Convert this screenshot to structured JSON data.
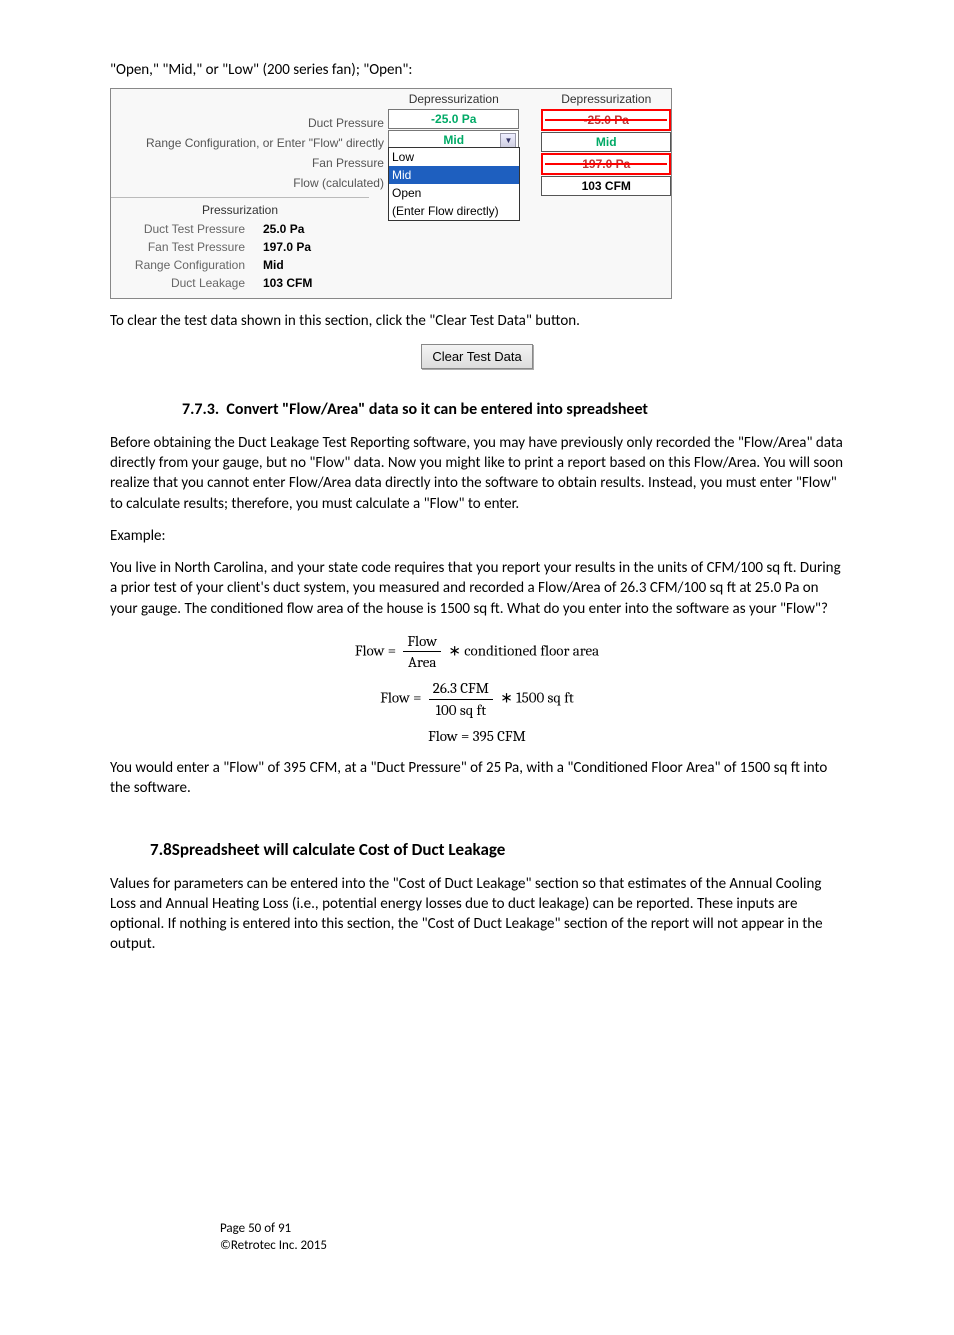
{
  "intro": "\"Open,\" \"Mid,\" or \"Low\" (200 series fan); \"Open\":",
  "ss": {
    "labels": {
      "header": "Depressurization",
      "duct_pressure": "Duct Pressure",
      "range": "Range Configuration, or Enter \"Flow\" directly",
      "fan_pressure": "Fan Pressure",
      "flow": "Flow (calculated)"
    },
    "mid": {
      "duct_val": "-25.0 Pa",
      "range_val": "Mid",
      "dd": {
        "low": "Low",
        "mid": "Mid",
        "open": "Open",
        "enter": "(Enter Flow directly)"
      }
    },
    "right": {
      "header": "Depressurization",
      "v1": "-25.0 Pa",
      "v2": "Mid",
      "v3": "197.0 Pa",
      "v4": "103 CFM"
    },
    "bottom": {
      "header": "Pressurization",
      "rows": [
        {
          "label": "Duct Test Pressure",
          "val": "25.0 Pa"
        },
        {
          "label": "Fan Test Pressure",
          "val": "197.0 Pa"
        },
        {
          "label": "Range Configuration",
          "val": "Mid"
        },
        {
          "label": "Duct Leakage",
          "val": "103 CFM"
        }
      ]
    }
  },
  "clear_text": "To clear the test data shown in this section, click the \"Clear Test Data\" button.",
  "clear_btn": "Clear Test Data",
  "h773_num": "7.7.3.",
  "h773_title": "Convert \"Flow/Area\" data so it can be entered into spreadsheet",
  "p773a": "Before obtaining the Duct Leakage Test Reporting software, you may have previously only recorded the \"Flow/Area\" data directly from your gauge, but no \"Flow\" data.  Now you might like to print a report based on this Flow/Area.  You will soon realize that you cannot enter Flow/Area data directly into the software to obtain results.  Instead, you must enter \"Flow\" to calculate results; therefore, you must calculate a \"Flow\" to enter.",
  "example_label": "Example:",
  "p773b": "You live in North Carolina, and your state code requires that you report your results in the units of CFM/100 sq ft.  During a prior test of your client's duct system, you measured and recorded a Flow/Area of 26.3 CFM/100 sq ft at 25.0 Pa on your gauge.  The conditioned flow area of the house is 1500 sq ft.  What do you enter into the software as your \"Flow\"?",
  "eq": {
    "e1_lhs": "Flow =",
    "e1_num": "Flow",
    "e1_den": "Area",
    "e1_rhs": "∗ conditioned floor area",
    "e2_lhs": "Flow =",
    "e2_num": "26.3 CFM",
    "e2_den": "100 sq ft",
    "e2_rhs": "∗ 1500 sq ft",
    "e3": "Flow = 395 CFM"
  },
  "p773c": "You would enter a \"Flow\" of 395 CFM, at a \"Duct Pressure\" of 25 Pa, with a \"Conditioned Floor Area\" of 1500 sq ft into the software.",
  "h78_num": "7.8",
  "h78_title": "Spreadsheet will calculate Cost of Duct Leakage",
  "p78": "Values for parameters can be entered into the \"Cost of Duct Leakage\" section so that estimates of the Annual Cooling Loss and Annual Heating Loss (i.e., potential energy losses due to duct leakage) can be reported.  These inputs are optional.  If nothing is entered into this section, the \"Cost of Duct Leakage\" section of the report will not appear in the output.",
  "footer": {
    "page": "Page 50 of 91",
    "copyright": "©Retrotec Inc. 2015"
  }
}
